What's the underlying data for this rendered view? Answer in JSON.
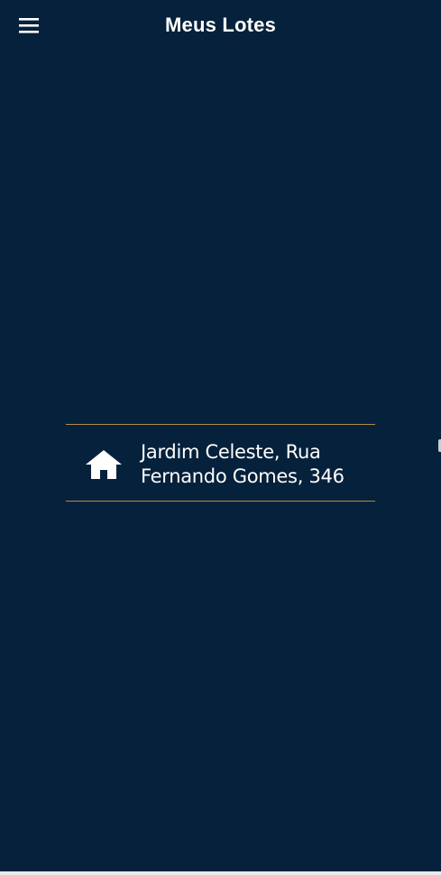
{
  "app_bar": {
    "title": "Meus Lotes",
    "menu_icon": "hamburger-menu-icon"
  },
  "lots": [
    {
      "icon": "home-icon",
      "address": "Jardim Celeste, Rua Fernando Gomes, 346"
    }
  ],
  "colors": {
    "background": "#06213b",
    "divider": "#b08a45",
    "text": "#ffffff"
  }
}
